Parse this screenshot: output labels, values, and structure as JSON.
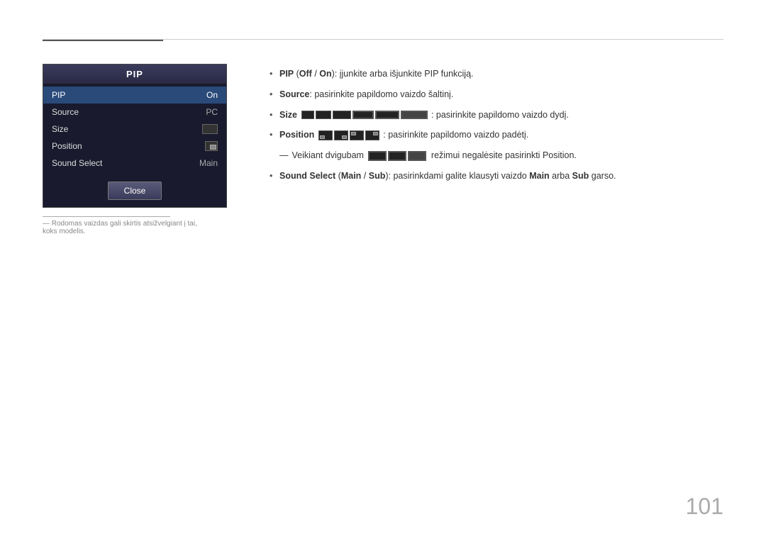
{
  "page": {
    "number": "101"
  },
  "top_accent": {
    "visible": true
  },
  "pip_menu": {
    "title": "PIP",
    "rows": [
      {
        "label": "PIP",
        "value": "On",
        "type": "text",
        "active": true
      },
      {
        "label": "Source",
        "value": "PC",
        "type": "text",
        "active": false
      },
      {
        "label": "Size",
        "value": "",
        "type": "icon-size",
        "active": false
      },
      {
        "label": "Position",
        "value": "",
        "type": "icon-pos",
        "active": false
      },
      {
        "label": "Sound Select",
        "value": "Main",
        "type": "text",
        "active": false
      }
    ],
    "close_button": "Close"
  },
  "footnote": {
    "text": "― Rodomas vaizdas gali skirtis atsižvelgiant į tai, koks modelis."
  },
  "descriptions": [
    {
      "id": "pip-onoff",
      "text_parts": [
        {
          "text": "PIP (",
          "style": "normal"
        },
        {
          "text": "Off",
          "style": "bold"
        },
        {
          "text": " / ",
          "style": "normal"
        },
        {
          "text": "On",
          "style": "bold"
        },
        {
          "text": "): įjunkite arba išjunkite PIP funkciją.",
          "style": "normal"
        }
      ]
    },
    {
      "id": "source",
      "text_parts": [
        {
          "text": "Source",
          "style": "bold"
        },
        {
          "text": ": pasirinkite papildomo vaizdo šaltinį.",
          "style": "normal"
        }
      ]
    },
    {
      "id": "size",
      "text_parts": [
        {
          "text": "Size",
          "style": "bold"
        },
        {
          "text": " ",
          "style": "normal"
        },
        {
          "text": "[icons]",
          "style": "size-icons"
        },
        {
          "text": ": pasirinkite papildomo vaizdo dydį.",
          "style": "normal"
        }
      ]
    },
    {
      "id": "position",
      "text_parts": [
        {
          "text": "Position",
          "style": "bold"
        },
        {
          "text": " ",
          "style": "normal"
        },
        {
          "text": "[pos-icons]",
          "style": "pos-icons"
        },
        {
          "text": ": pasirinkite papildomo vaizdo padėtį.",
          "style": "normal"
        }
      ]
    },
    {
      "id": "position-note",
      "type": "subnote",
      "text_parts": [
        {
          "text": "Veikiant dvigubam ",
          "style": "normal"
        },
        {
          "text": "[mode-icons]",
          "style": "mode-icons"
        },
        {
          "text": " režimui negalėsite pasirinkti ",
          "style": "normal"
        },
        {
          "text": "Position",
          "style": "bold-orange"
        },
        {
          "text": ".",
          "style": "normal"
        }
      ]
    },
    {
      "id": "sound-select",
      "text_parts": [
        {
          "text": "Sound Select",
          "style": "bold"
        },
        {
          "text": " (",
          "style": "normal"
        },
        {
          "text": "Main",
          "style": "bold"
        },
        {
          "text": " / ",
          "style": "normal"
        },
        {
          "text": "Sub",
          "style": "bold"
        },
        {
          "text": "): pasirinkdami galite klausyti vaizdo ",
          "style": "normal"
        },
        {
          "text": "Main",
          "style": "bold"
        },
        {
          "text": " arba ",
          "style": "normal"
        },
        {
          "text": "Sub",
          "style": "bold"
        },
        {
          "text": " garso.",
          "style": "normal"
        }
      ]
    }
  ]
}
